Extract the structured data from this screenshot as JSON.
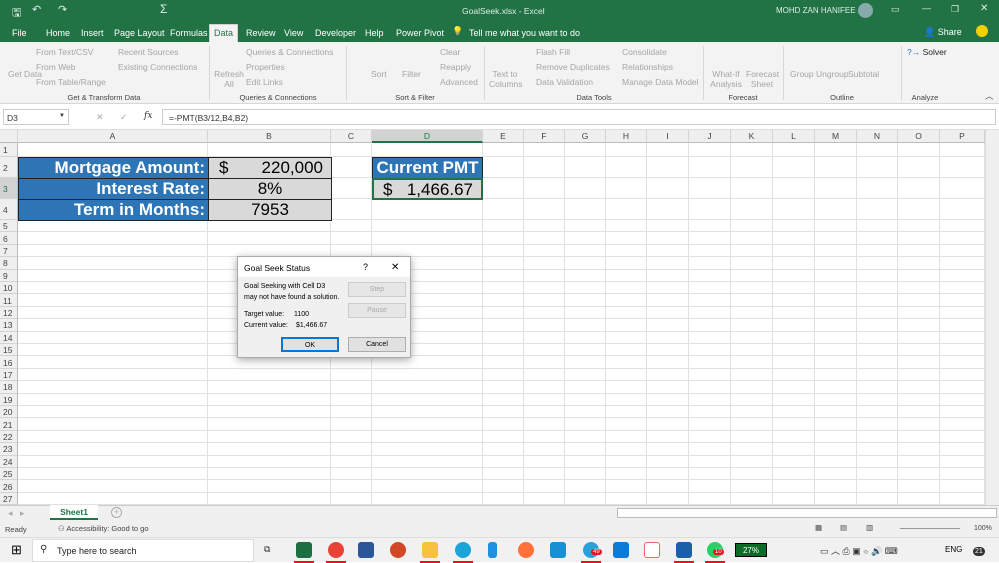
{
  "window": {
    "title": "GoalSeek.xlsx  -  Excel",
    "user": "MOHD ZAN HANIFEE"
  },
  "tabs": [
    "File",
    "Home",
    "Insert",
    "Page Layout",
    "Formulas",
    "Data",
    "Review",
    "View",
    "Developer",
    "Help",
    "Power Pivot"
  ],
  "tell_me": "Tell me what you want to do",
  "share": "Share",
  "ribbon": {
    "get_data": "Get Data",
    "from_text": "From Text/CSV",
    "from_web": "From Web",
    "from_table": "From Table/Range",
    "recent": "Recent Sources",
    "existing": "Existing Connections",
    "refresh": "Refresh All",
    "queries": "Queries & Connections",
    "properties": "Properties",
    "edit_links": "Edit Links",
    "sort": "Sort",
    "filter": "Filter",
    "clear": "Clear",
    "reapply": "Reapply",
    "advanced": "Advanced",
    "text_to_columns": "Text to Columns",
    "flash_fill": "Flash Fill",
    "remove_dup": "Remove Duplicates",
    "data_validation": "Data Validation",
    "consolidate": "Consolidate",
    "relationships": "Relationships",
    "manage_model": "Manage Data Model",
    "whatif": "What-If Analysis",
    "forecast_sheet": "Forecast Sheet",
    "group": "Group",
    "ungroup": "Ungroup",
    "subtotal": "Subtotal",
    "solver": "Solver",
    "groups": [
      "Get & Transform Data",
      "Queries & Connections",
      "Sort & Filter",
      "Data Tools",
      "Forecast",
      "Outline",
      "Analyze"
    ]
  },
  "formula_bar": {
    "name_box": "D3",
    "formula": "=-PMT(B3/12,B4,B2)",
    "fx": "fx"
  },
  "columns": [
    "A",
    "B",
    "C",
    "D",
    "E",
    "F",
    "G",
    "H",
    "I",
    "J",
    "K",
    "L",
    "M",
    "N",
    "O",
    "P"
  ],
  "cells": {
    "A2": "Mortgage Amount:",
    "A3": "Interest Rate:",
    "A4": "Term in Months:",
    "B2_cur": "$",
    "B2": "220,000",
    "B3": "8%",
    "B4": "7953",
    "D2": "Current PMT",
    "D3_cur": "$",
    "D3": "1,466.67"
  },
  "dialog": {
    "title": "Goal Seek Status",
    "help": "?",
    "close": "✕",
    "msg1": "Goal Seeking with Cell D3",
    "msg2": "may not have found a solution.",
    "target_label": "Target value:",
    "target": "1100",
    "current_label": "Current value:",
    "current": "$1,466.67",
    "step": "Step",
    "pause": "Pause",
    "ok": "OK",
    "cancel": "Cancel"
  },
  "sheet_tab": "Sheet1",
  "status": {
    "ready": "Ready",
    "accessibility": "Accessibility: Good to go",
    "zoom": "100%"
  },
  "taskbar": {
    "search": "Type here to search",
    "battery": "27%",
    "lang": "ENG",
    "badge_telegram": "49",
    "badge_whatsapp": "10",
    "notif": "21"
  }
}
